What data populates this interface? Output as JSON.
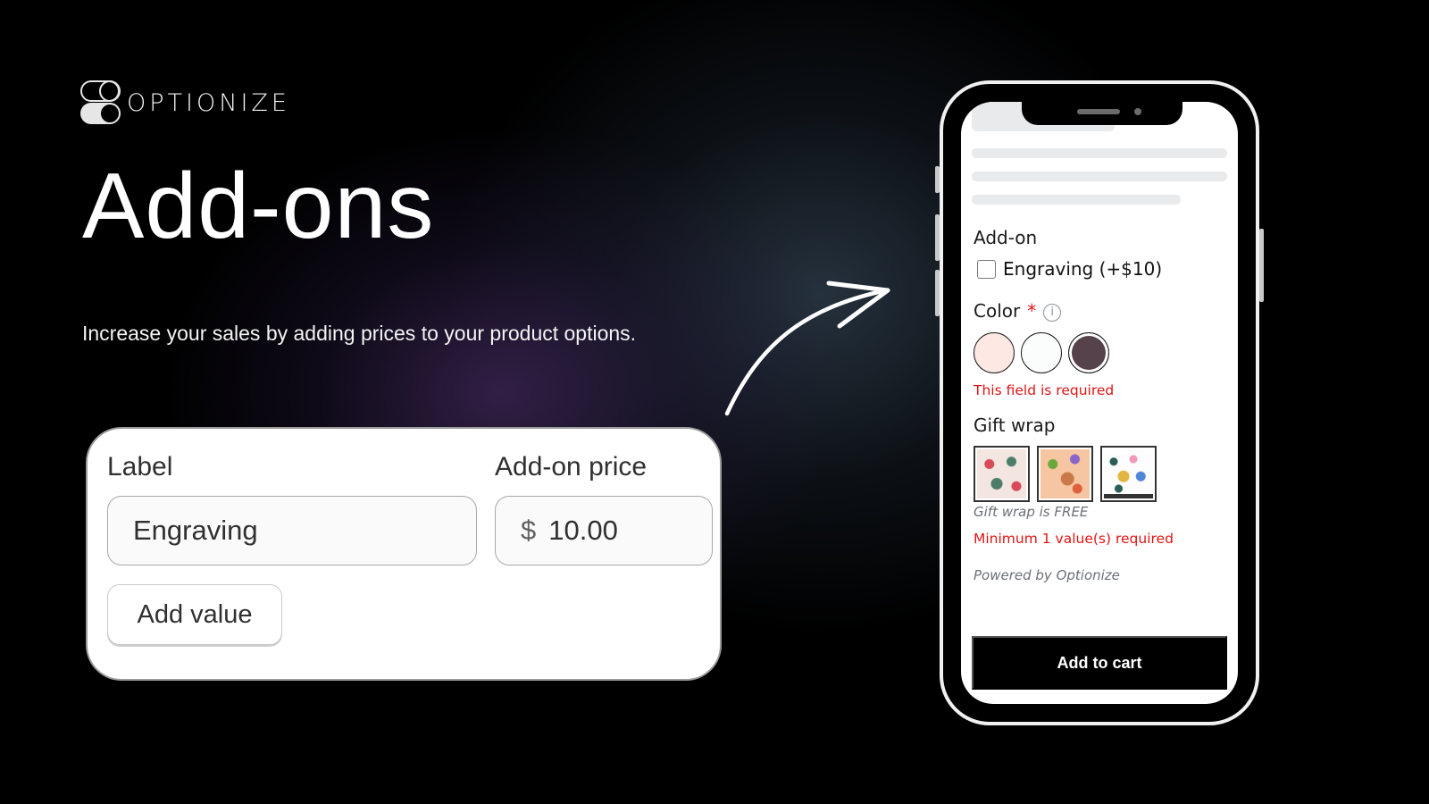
{
  "brand": {
    "name": "OPTIONIZE",
    "icon": "toggle-logo-icon"
  },
  "hero": {
    "title": "Add-ons",
    "subtitle": "Increase your sales by adding prices to your product options."
  },
  "editor_card": {
    "label_heading": "Label",
    "price_heading": "Add-on price",
    "label_value": "Engraving",
    "price_currency": "$",
    "price_value": "10.00",
    "add_value_button": "Add value"
  },
  "arrow": {
    "icon": "curved-arrow-icon"
  },
  "phone": {
    "addon_section": {
      "label": "Add-on",
      "checkbox_label": "Engraving (+$10)",
      "checked": false
    },
    "color_section": {
      "label": "Color",
      "required_mark": "*",
      "info_icon": "i",
      "swatches": [
        {
          "name": "light-pink",
          "color": "#fde8e4",
          "selected": false
        },
        {
          "name": "white",
          "color": "#fbfdfc",
          "selected": false
        },
        {
          "name": "dark-plum",
          "color": "#55424a",
          "selected": true
        }
      ],
      "error": "This field is required"
    },
    "gift_wrap_section": {
      "label": "Gift wrap",
      "patterns": [
        "red-green-gift-pattern",
        "peach-party-pattern",
        "white-confetti-gift-pattern"
      ],
      "note": "Gift wrap is FREE",
      "error": "Minimum 1 value(s) required"
    },
    "powered_by": "Powered by Optionize",
    "add_to_cart": "Add to cart"
  },
  "colors": {
    "error_red": "#e21414",
    "background": "#000000",
    "button_black": "#000000"
  }
}
